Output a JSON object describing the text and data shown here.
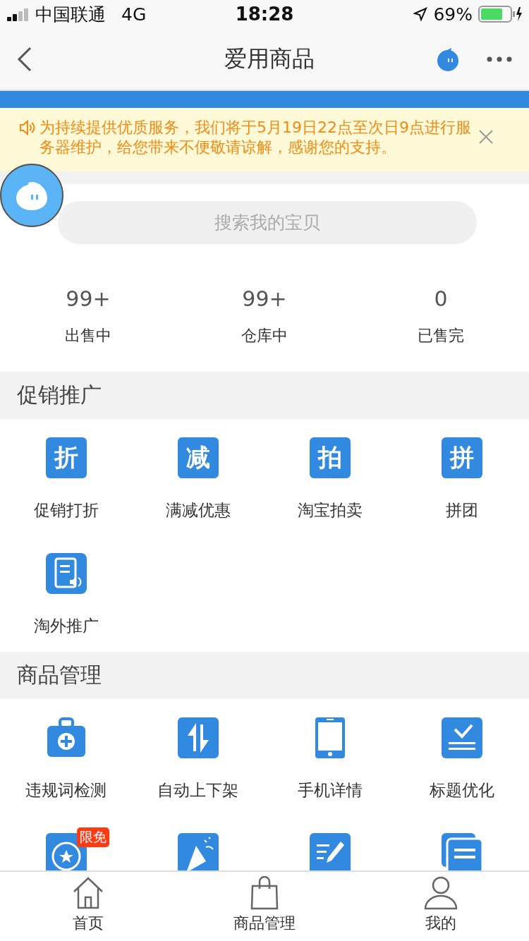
{
  "status_bar": {
    "carrier": "中国联通",
    "network": "4G",
    "time": "18:28",
    "battery": "69%"
  },
  "nav": {
    "title": "爱用商品"
  },
  "notice": {
    "text": "为持续提供优质服务，我们将于5月19日22点至次日9点进行服务器维护，给您带来不便敬请谅解，感谢您的支持。"
  },
  "search": {
    "placeholder": "搜索我的宝贝"
  },
  "stats": [
    {
      "value": "99+",
      "label": "出售中"
    },
    {
      "value": "99+",
      "label": "仓库中"
    },
    {
      "value": "0",
      "label": "已售完"
    }
  ],
  "sections": [
    {
      "title": "促销推广",
      "items": [
        {
          "kind": "glyph",
          "glyph": "折",
          "label": "促销打折"
        },
        {
          "kind": "glyph",
          "glyph": "减",
          "label": "满减优惠"
        },
        {
          "kind": "glyph",
          "glyph": "拍",
          "label": "淘宝拍卖"
        },
        {
          "kind": "glyph",
          "glyph": "拼",
          "label": "拼团"
        },
        {
          "kind": "icon",
          "label": "淘外推广"
        }
      ]
    },
    {
      "title": "商品管理",
      "items": [
        {
          "kind": "icon",
          "label": "违规词检测"
        },
        {
          "kind": "icon",
          "label": "自动上下架"
        },
        {
          "kind": "icon",
          "label": "手机详情"
        },
        {
          "kind": "icon",
          "label": "标题优化"
        },
        {
          "kind": "icon",
          "badge": "限免"
        },
        {
          "kind": "icon"
        },
        {
          "kind": "icon"
        },
        {
          "kind": "icon"
        }
      ]
    }
  ],
  "tabs": [
    {
      "label": "首页"
    },
    {
      "label": "商品管理"
    },
    {
      "label": "我的"
    }
  ]
}
